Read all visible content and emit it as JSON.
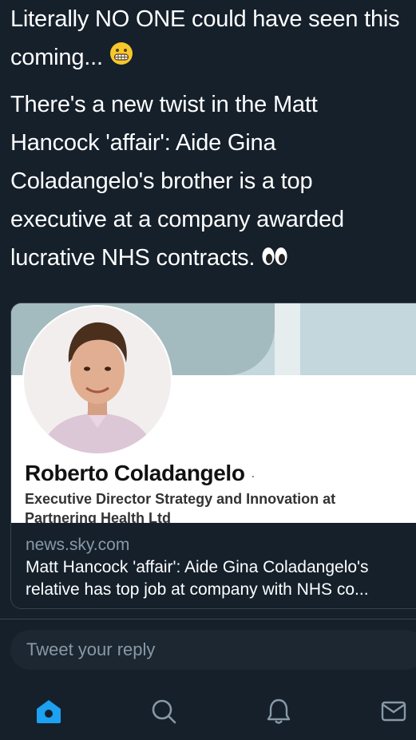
{
  "tweet": {
    "line1": "Literally NO ONE could have seen this coming...",
    "line2": "There's a new twist in the Matt Hancock 'affair': Aide Gina Coladangelo's brother is a top executive at a company awarded lucrative NHS contracts."
  },
  "card": {
    "profile_name": "Roberto Coladangelo",
    "profile_title": "Executive Director Strategy and Innovation at Partnering Health Ltd",
    "domain": "news.sky.com",
    "description": "Matt Hancock 'affair': Aide Gina Coladangelo's relative has top job at company with NHS co..."
  },
  "reply": {
    "placeholder": "Tweet your reply"
  },
  "tabs": [
    "home-icon",
    "search-icon",
    "notifications-icon",
    "messages-icon"
  ],
  "colors": {
    "background": "#15202b",
    "accent": "#1da1f2",
    "muted": "#8899a6"
  }
}
